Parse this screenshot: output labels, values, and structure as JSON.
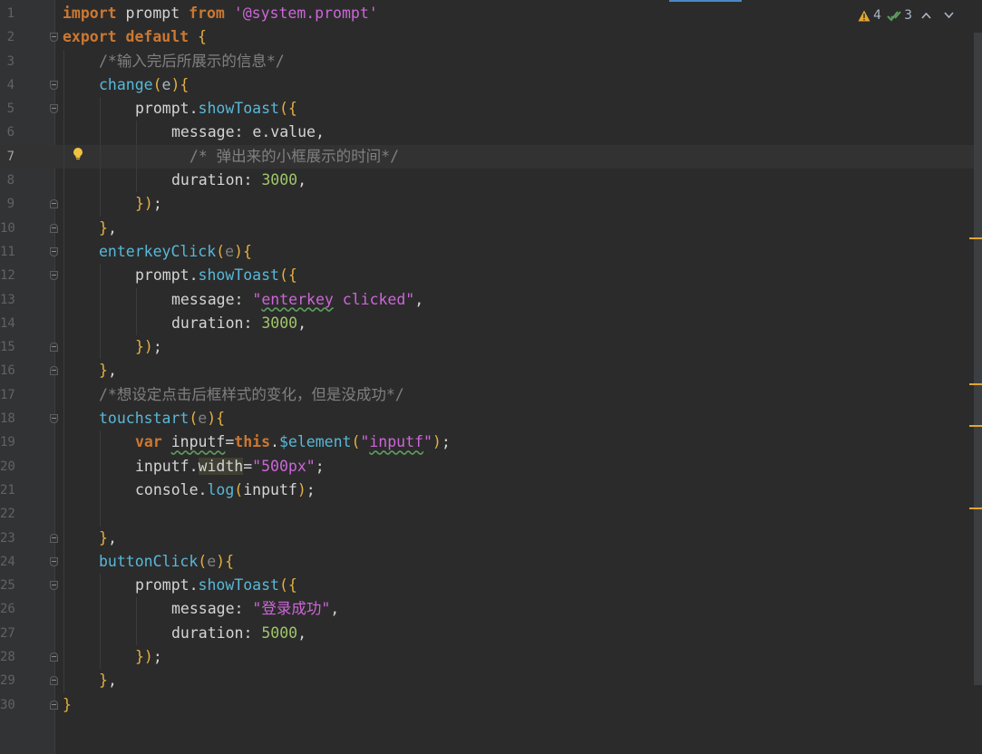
{
  "editor": {
    "lines": [
      {
        "n": "1",
        "indent": 0,
        "current": false,
        "fold": "none",
        "tokens": [
          [
            "kwb",
            "import"
          ],
          [
            "plain",
            " prompt "
          ],
          [
            "kwb",
            "from"
          ],
          [
            "plain",
            " "
          ],
          [
            "str2",
            "'@system.prompt'"
          ]
        ]
      },
      {
        "n": "2",
        "indent": 0,
        "current": false,
        "fold": "open",
        "tokens": [
          [
            "kwb",
            "export"
          ],
          [
            "plain",
            " "
          ],
          [
            "kwb",
            "default"
          ],
          [
            "plain",
            " "
          ],
          [
            "punc",
            "{"
          ]
        ]
      },
      {
        "n": "3",
        "indent": 1,
        "current": false,
        "fold": "none",
        "tokens": [
          [
            "cm",
            "/*输入完后所展示的信息*/"
          ]
        ]
      },
      {
        "n": "4",
        "indent": 1,
        "current": false,
        "fold": "open",
        "tokens": [
          [
            "fn",
            "change"
          ],
          [
            "punc",
            "("
          ],
          [
            "param",
            "e"
          ],
          [
            "punc",
            ")"
          ],
          [
            "punc",
            "{"
          ]
        ]
      },
      {
        "n": "5",
        "indent": 2,
        "current": false,
        "fold": "open",
        "tokens": [
          [
            "plain",
            "prompt."
          ],
          [
            "method",
            "showToast"
          ],
          [
            "punc",
            "({"
          ]
        ]
      },
      {
        "n": "6",
        "indent": 3,
        "current": false,
        "fold": "none",
        "tokens": [
          [
            "plain",
            "message: e.value,"
          ]
        ]
      },
      {
        "n": "7",
        "indent": 3,
        "current": true,
        "fold": "none",
        "bulb": true,
        "tokens": [
          [
            "cm",
            "  /* 弹出来的小框展示的时间*/"
          ]
        ]
      },
      {
        "n": "8",
        "indent": 3,
        "current": false,
        "fold": "none",
        "tokens": [
          [
            "plain",
            "duration: "
          ],
          [
            "num",
            "3000"
          ],
          [
            "plain",
            ","
          ]
        ]
      },
      {
        "n": "9",
        "indent": 2,
        "current": false,
        "fold": "close",
        "tokens": [
          [
            "punc",
            "})"
          ],
          [
            "plain",
            ";"
          ]
        ]
      },
      {
        "n": "10",
        "indent": 1,
        "current": false,
        "fold": "close",
        "tokens": [
          [
            "punc",
            "}"
          ],
          [
            "plain",
            ","
          ]
        ]
      },
      {
        "n": "11",
        "indent": 1,
        "current": false,
        "fold": "open",
        "tokens": [
          [
            "fn",
            "enterkeyClick"
          ],
          [
            "punc",
            "("
          ],
          [
            "cm",
            "e"
          ],
          [
            "punc",
            ")"
          ],
          [
            "punc",
            "{"
          ]
        ]
      },
      {
        "n": "12",
        "indent": 2,
        "current": false,
        "fold": "open",
        "tokens": [
          [
            "plain",
            "prompt."
          ],
          [
            "method",
            "showToast"
          ],
          [
            "punc",
            "({"
          ]
        ]
      },
      {
        "n": "13",
        "indent": 3,
        "current": false,
        "fold": "none",
        "tokens": [
          [
            "plain",
            "message: "
          ],
          [
            "str2",
            "\""
          ],
          [
            "str2 typo",
            "enterkey"
          ],
          [
            "str2",
            " clicked\""
          ],
          [
            "plain",
            ","
          ]
        ]
      },
      {
        "n": "14",
        "indent": 3,
        "current": false,
        "fold": "none",
        "tokens": [
          [
            "plain",
            "duration: "
          ],
          [
            "num",
            "3000"
          ],
          [
            "plain",
            ","
          ]
        ]
      },
      {
        "n": "15",
        "indent": 2,
        "current": false,
        "fold": "close",
        "tokens": [
          [
            "punc",
            "})"
          ],
          [
            "plain",
            ";"
          ]
        ]
      },
      {
        "n": "16",
        "indent": 1,
        "current": false,
        "fold": "close",
        "tokens": [
          [
            "punc",
            "}"
          ],
          [
            "plain",
            ","
          ]
        ]
      },
      {
        "n": "17",
        "indent": 1,
        "current": false,
        "fold": "none",
        "tokens": [
          [
            "cm",
            "/*想设定点击后框样式的变化，但是没成功*/"
          ]
        ]
      },
      {
        "n": "18",
        "indent": 1,
        "current": false,
        "fold": "open",
        "tokens": [
          [
            "fn",
            "touchstart"
          ],
          [
            "punc",
            "("
          ],
          [
            "cm",
            "e"
          ],
          [
            "punc",
            ")"
          ],
          [
            "punc",
            "{"
          ]
        ]
      },
      {
        "n": "19",
        "indent": 2,
        "current": false,
        "fold": "none",
        "tokens": [
          [
            "kwb",
            "var"
          ],
          [
            "plain",
            " "
          ],
          [
            "plain typo",
            "inputf"
          ],
          [
            "plain",
            "="
          ],
          [
            "kwb",
            "this"
          ],
          [
            "plain",
            "."
          ],
          [
            "method",
            "$element"
          ],
          [
            "punc",
            "("
          ],
          [
            "str2",
            "\""
          ],
          [
            "str2 typo",
            "inputf"
          ],
          [
            "str2",
            "\""
          ],
          [
            "punc",
            ")"
          ],
          [
            "plain",
            ";"
          ]
        ]
      },
      {
        "n": "20",
        "indent": 2,
        "current": false,
        "fold": "none",
        "tokens": [
          [
            "plain",
            "inputf."
          ],
          [
            "plain hl",
            "width"
          ],
          [
            "plain",
            "="
          ],
          [
            "str2",
            "\"500px\""
          ],
          [
            "plain",
            ";"
          ]
        ]
      },
      {
        "n": "21",
        "indent": 2,
        "current": false,
        "fold": "none",
        "tokens": [
          [
            "plain",
            "console."
          ],
          [
            "method",
            "log"
          ],
          [
            "punc",
            "("
          ],
          [
            "plain",
            "inputf"
          ],
          [
            "punc",
            ")"
          ],
          [
            "plain",
            ";"
          ]
        ]
      },
      {
        "n": "22",
        "indent": 2,
        "current": false,
        "fold": "none",
        "tokens": []
      },
      {
        "n": "23",
        "indent": 1,
        "current": false,
        "fold": "close",
        "tokens": [
          [
            "punc",
            "}"
          ],
          [
            "plain",
            ","
          ]
        ]
      },
      {
        "n": "24",
        "indent": 1,
        "current": false,
        "fold": "open",
        "tokens": [
          [
            "fn",
            "buttonClick"
          ],
          [
            "punc",
            "("
          ],
          [
            "cm",
            "e"
          ],
          [
            "punc",
            ")"
          ],
          [
            "punc",
            "{"
          ]
        ]
      },
      {
        "n": "25",
        "indent": 2,
        "current": false,
        "fold": "open",
        "tokens": [
          [
            "plain",
            "prompt."
          ],
          [
            "method",
            "showToast"
          ],
          [
            "punc",
            "({"
          ]
        ]
      },
      {
        "n": "26",
        "indent": 3,
        "current": false,
        "fold": "none",
        "tokens": [
          [
            "plain",
            "message: "
          ],
          [
            "str2",
            "\"登录成功\""
          ],
          [
            "plain",
            ","
          ]
        ]
      },
      {
        "n": "27",
        "indent": 3,
        "current": false,
        "fold": "none",
        "tokens": [
          [
            "plain",
            "duration: "
          ],
          [
            "num",
            "5000"
          ],
          [
            "plain",
            ","
          ]
        ]
      },
      {
        "n": "28",
        "indent": 2,
        "current": false,
        "fold": "close",
        "tokens": [
          [
            "punc",
            "})"
          ],
          [
            "plain",
            ";"
          ]
        ]
      },
      {
        "n": "29",
        "indent": 1,
        "current": false,
        "fold": "close",
        "tokens": [
          [
            "punc",
            "}"
          ],
          [
            "plain",
            ","
          ]
        ]
      },
      {
        "n": "30",
        "indent": 0,
        "current": false,
        "fold": "close",
        "tokens": [
          [
            "punc",
            "}"
          ]
        ]
      }
    ]
  },
  "inspection": {
    "warnings": "4",
    "weak_warnings": "3",
    "warning_color": "#e0a630",
    "ok_color": "#5e9e5e"
  },
  "scroll_markers": [
    "warning",
    "warning",
    "warning",
    "warning"
  ]
}
